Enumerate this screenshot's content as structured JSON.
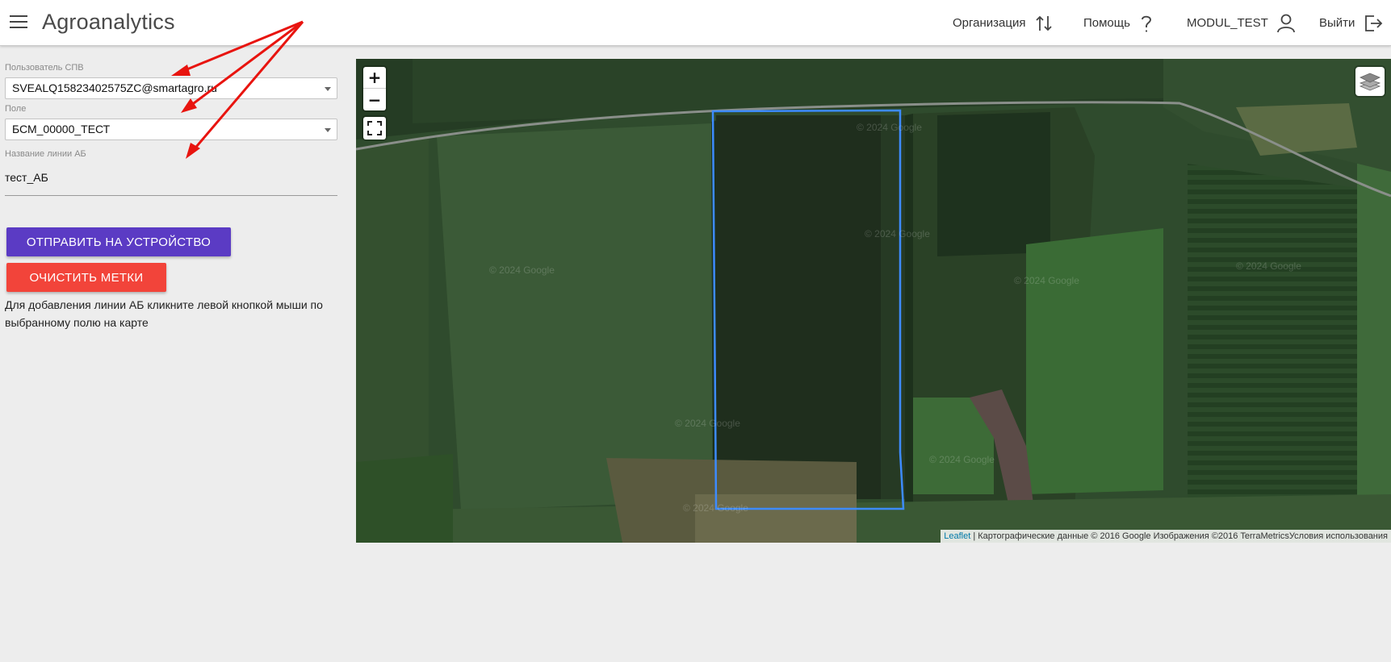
{
  "header": {
    "title": "Agroanalytics",
    "organization_label": "Организация",
    "help_label": "Помощь",
    "user_label": "MODUL_TEST",
    "exit_label": "Выйти"
  },
  "form": {
    "user_label": "Пользователь СПВ",
    "user_value": "SVEALQ15823402575ZC@smartagro.ru",
    "field_label": "Поле",
    "field_value": "БСМ_00000_ТЕСТ",
    "ab_name_label": "Название линии АБ",
    "ab_name_value": "тест_АБ",
    "send_button": "ОТПРАВИТЬ НА УСТРОЙСТВО",
    "clear_button": "ОЧИСТИТЬ МЕТКИ",
    "hint": "Для добавления линии АБ кликните левой кнопкой мыши по выбранному полю на карте"
  },
  "map": {
    "zoom_in": "+",
    "zoom_out": "−",
    "watermark": "© 2024 Google",
    "attribution_link": "Leaflet",
    "attribution_text": " | Картографические данные © 2016 Google Изображения ©2016 TerraMetricsУсловия использования",
    "field_outline_color": "#3d8bff"
  },
  "colors": {
    "send_button": "#5b3bc4",
    "clear_button": "#f2443a",
    "arrow": "#e8140f"
  }
}
